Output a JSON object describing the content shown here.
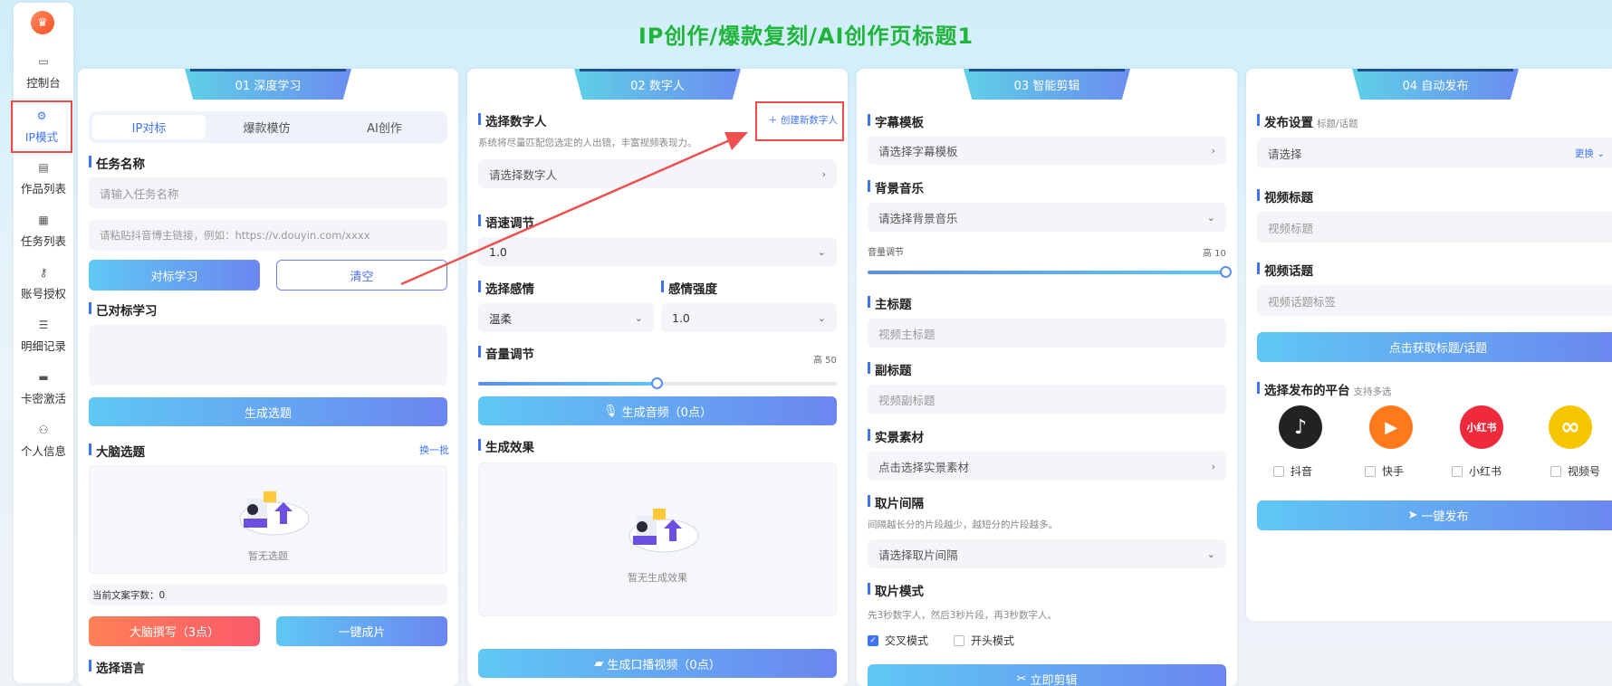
{
  "title": "IP创作/爆款复刻/AI创作页标题1",
  "sidebar": [
    {
      "label": "控制台",
      "icon": "monitor-icon"
    },
    {
      "label": "IP模式",
      "icon": "gear-icon"
    },
    {
      "label": "作品列表",
      "icon": "document-icon"
    },
    {
      "label": "任务列表",
      "icon": "clipboard-icon"
    },
    {
      "label": "账号授权",
      "icon": "key-icon"
    },
    {
      "label": "明细记录",
      "icon": "list-icon"
    },
    {
      "label": "卡密激活",
      "icon": "card-icon"
    },
    {
      "label": "个人信息",
      "icon": "user-icon"
    }
  ],
  "p1": {
    "tab": "01 深度学习",
    "seg": [
      "IP对标",
      "爆款模仿",
      "AI创作"
    ],
    "task_label": "任务名称",
    "task_ph": "请输入任务名称",
    "link_ph": "请粘贴抖音博主链接，例如：https://v.douyin.com/xxxx",
    "btn_learn": "对标学习",
    "btn_clear": "清空",
    "learned_label": "已对标学习",
    "btn_gen_topic": "生成选题",
    "brain_label": "大脑选题",
    "refresh": "换一批",
    "empty_topic": "暂无选题",
    "count": "当前文案字数：0",
    "btn_brain": "大脑撰写（3点）",
    "btn_one": "一键成片",
    "lang_label": "选择语言"
  },
  "p2": {
    "tab": "02 数字人",
    "select_label": "选择数字人",
    "create": "创建新数字人",
    "hint": "系统将尽量匹配您选定的人出镜，丰富视频表现力。",
    "select_ph": "请选择数字人",
    "speed_label": "语速调节",
    "speed_val": "1.0",
    "emotion_label": "选择感情",
    "emotion_val": "温柔",
    "intensity_label": "感情强度",
    "intensity_val": "1.0",
    "volume_label": "音量调节",
    "volume_right": "高 50",
    "volume_level": 0.5,
    "btn_audio": "生成音频（0点）",
    "effect_label": "生成效果",
    "empty_effect": "暂无生成效果",
    "btn_video": "生成口播视频（0点）"
  },
  "p3": {
    "tab": "03 智能剪辑",
    "subtitle_label": "字幕模板",
    "subtitle_ph": "请选择字幕模板",
    "bgm_label": "背景音乐",
    "bgm_ph": "请选择背景音乐",
    "vol_label": "音量调节",
    "vol_right": "高 10",
    "vol_level": 1.0,
    "main_label": "主标题",
    "main_ph": "视频主标题",
    "sub_label": "副标题",
    "sub_ph": "视频副标题",
    "material_label": "实景素材",
    "material_ph": "点击选择实景素材",
    "interval_label": "取片间隔",
    "interval_hint": "间隔越长分的片段越少，越短分的片段越多。",
    "interval_ph": "请选择取片间隔",
    "mode_label": "取片模式",
    "mode_hint": "先3秒数字人，然后3秒片段，再3秒数字人。",
    "mode_cross": "交叉模式",
    "mode_head": "开头模式",
    "btn_edit": "立即剪辑"
  },
  "p4": {
    "tab": "04 自动发布",
    "pub_label": "发布设置",
    "pub_sub": "标题/话题",
    "pub_ph": "请选择",
    "pub_change": "更换",
    "vtitle_label": "视频标题",
    "vtitle_ph": "视频标题",
    "vtopic_label": "视频话题",
    "vtopic_ph": "视频话题标签",
    "btn_get": "点击获取标题/话题",
    "plat_label": "选择发布的平台",
    "plat_sub": "支持多选",
    "platforms": [
      {
        "name": "抖音",
        "glyph": "♪",
        "color": "#222222"
      },
      {
        "name": "快手",
        "glyph": "▶",
        "color": "#ff7a1a"
      },
      {
        "name": "小红书",
        "glyph": "小红书",
        "color": "#ee2a3c"
      },
      {
        "name": "视频号",
        "glyph": "∞",
        "color": "#f7c500"
      }
    ],
    "btn_publish": "一键发布"
  }
}
